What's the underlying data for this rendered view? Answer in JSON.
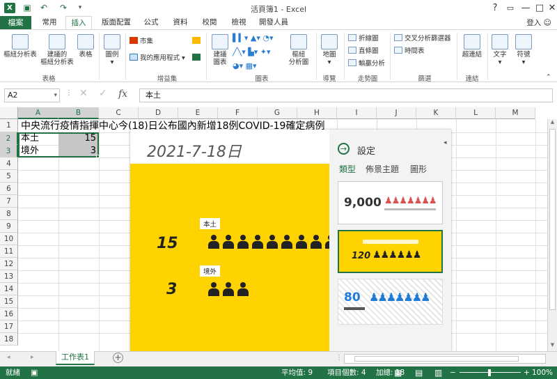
{
  "window": {
    "title": "活頁簿1 - Excel",
    "help": "?",
    "minimize": "—",
    "restore": "□",
    "close": "✕"
  },
  "file_tab": "檔案",
  "tabs": [
    "常用",
    "插入",
    "版面配置",
    "公式",
    "資料",
    "校閱",
    "檢視",
    "開發人員"
  ],
  "active_tab": "插入",
  "signin": "登入",
  "ribbon": {
    "groups": [
      {
        "label": "表格",
        "buttons": [
          "樞紐分析表",
          "建議的\n樞紐分析表",
          "表格"
        ]
      },
      {
        "label": "",
        "buttons": [
          "圖例"
        ]
      },
      {
        "label": "增益集",
        "small": [
          "市集",
          "我的應用程式"
        ]
      },
      {
        "label": "圖表",
        "buttons": [
          "建議\n圖表",
          "樞紐\n分析圖"
        ]
      },
      {
        "label": "導覽",
        "buttons": [
          "地圖"
        ]
      },
      {
        "label": "走勢圖",
        "small": [
          "折線圖",
          "直條圖",
          "輸贏分析"
        ]
      },
      {
        "label": "篩選",
        "small": [
          "交叉分析篩選器",
          "時間表"
        ]
      },
      {
        "label": "連結",
        "buttons": [
          "超連結"
        ]
      },
      {
        "label": "",
        "buttons": [
          "文字",
          "符號"
        ]
      }
    ]
  },
  "formula_bar": {
    "name_box": "A2",
    "fx": "fx",
    "content": "本土"
  },
  "columns": [
    "A",
    "B",
    "C",
    "D",
    "E",
    "F",
    "G",
    "H",
    "I",
    "J",
    "K",
    "L",
    "M"
  ],
  "rows": [
    "1",
    "2",
    "3",
    "4",
    "5",
    "6",
    "7",
    "8",
    "9",
    "10",
    "11",
    "12",
    "13",
    "14",
    "15",
    "16",
    "17",
    "18"
  ],
  "cells": {
    "A1": "中央流行疫情指揮中心今(18)日公布國內新增18例COVID-19確定病例",
    "A2": "本土",
    "B2": "15",
    "A3": "境外",
    "B3": "3"
  },
  "people_graph": {
    "date": "2021-7-18日",
    "rows": [
      {
        "label": "本土",
        "value": 15
      },
      {
        "label": "境外",
        "value": 3
      }
    ],
    "colors": {
      "background": "#ffd300",
      "icon": "#222222"
    },
    "panel": {
      "title": "設定",
      "tabs": [
        "類型",
        "佈景主題",
        "圖形"
      ],
      "active_tab": "類型",
      "templates": [
        {
          "value": "9,000",
          "color": "#d9534f"
        },
        {
          "value": "120",
          "color": "#ffd300"
        },
        {
          "value": "80",
          "color": "#1f7bd6"
        }
      ]
    }
  },
  "sheet_tabs": [
    "工作表1"
  ],
  "status": {
    "ready": "就緒",
    "average": "平均值: 9",
    "count": "項目個數: 4",
    "sum": "加總: 18",
    "zoom": "100%"
  }
}
